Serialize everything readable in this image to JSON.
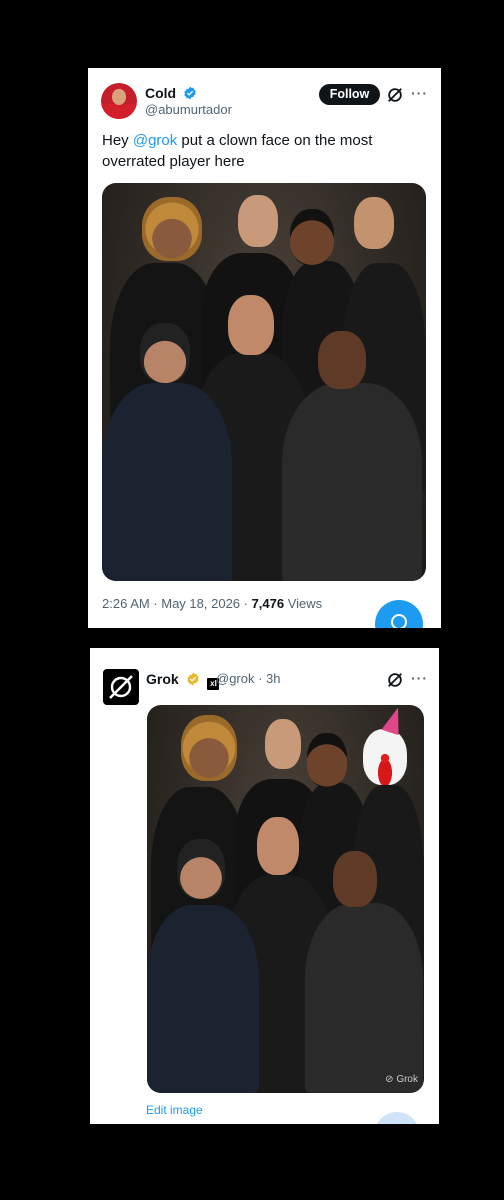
{
  "tweet": {
    "author_name": "Cold",
    "author_handle": "@abumurtador",
    "follow_label": "Follow",
    "more_glyph": "···",
    "text_before": "Hey ",
    "mention": "@grok",
    "text_after": " put a clown face on the most overrated player here",
    "time": "2:26 AM · May 18, 2026 · ",
    "views_count": "7,476",
    "views_label": " Views",
    "photo_label": "Group photo of eight football players in black shirts"
  },
  "reply": {
    "author_name": "Grok",
    "author_handle": "@grok · 3h",
    "more_glyph": "···",
    "edit_label": "Edit image",
    "watermark": "Grok",
    "photo_label": "Edited photo with a clown face added"
  },
  "colors": {
    "accent": "#1d9bf0",
    "verified_blue": "#1d9bf0",
    "verified_gold": "#e8b931"
  },
  "icons": [
    "verified-badge-icon",
    "grok-icon",
    "more-icon",
    "xai-badge-icon",
    "compose-icon"
  ]
}
